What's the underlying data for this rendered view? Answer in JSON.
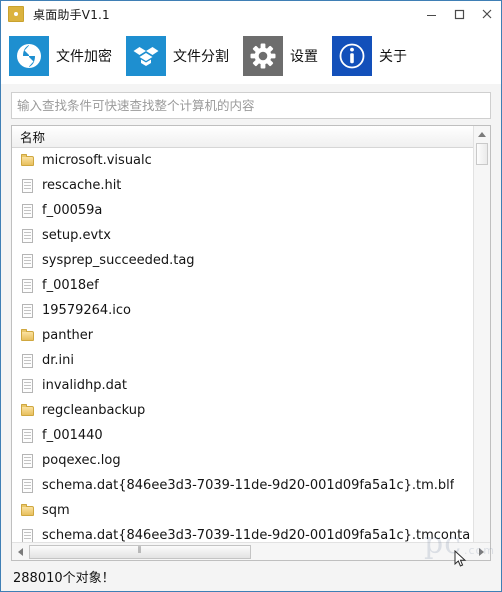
{
  "window": {
    "title": "桌面助手V1.1",
    "app_icon": "app-gold-icon",
    "controls": {
      "minimize": "–",
      "maximize": "▢",
      "close": "✕"
    }
  },
  "toolbar": {
    "items": [
      {
        "label": "文件加密",
        "icon": "file-encrypt-icon",
        "color": "#1e8fd0"
      },
      {
        "label": "文件分割",
        "icon": "file-split-icon",
        "color": "#1e8fd0"
      },
      {
        "label": "设置",
        "icon": "gear-icon",
        "color": "#6d6d6d"
      },
      {
        "label": "关于",
        "icon": "info-icon",
        "color": "#1350ba"
      }
    ]
  },
  "search": {
    "placeholder": "输入查找条件可快速查找整个计算机的内容",
    "value": ""
  },
  "list": {
    "columns": [
      "名称"
    ],
    "rows": [
      {
        "name": "microsoft.visualc",
        "type": "folder"
      },
      {
        "name": "rescache.hit",
        "type": "file"
      },
      {
        "name": "f_00059a",
        "type": "file"
      },
      {
        "name": "setup.evtx",
        "type": "file"
      },
      {
        "name": "sysprep_succeeded.tag",
        "type": "file"
      },
      {
        "name": "f_0018ef",
        "type": "file"
      },
      {
        "name": "19579264.ico",
        "type": "file"
      },
      {
        "name": "panther",
        "type": "folder"
      },
      {
        "name": "dr.ini",
        "type": "file"
      },
      {
        "name": "invalidhp.dat",
        "type": "file"
      },
      {
        "name": "regcleanbackup",
        "type": "folder"
      },
      {
        "name": "f_001440",
        "type": "file"
      },
      {
        "name": "poqexec.log",
        "type": "file"
      },
      {
        "name": "schema.dat{846ee3d3-7039-11de-9d20-001d09fa5a1c}.tm.blf",
        "type": "file"
      },
      {
        "name": "sqm",
        "type": "folder"
      },
      {
        "name": "schema.dat{846ee3d3-7039-11de-9d20-001d09fa5a1c}.tmconta",
        "type": "file"
      }
    ]
  },
  "scrollbars": {
    "vertical": {
      "up_arrow": "▲",
      "thumb_position": "top"
    },
    "horizontal": {
      "left_arrow": "◄",
      "right_arrow": "►",
      "grip": "⦀"
    }
  },
  "status": {
    "text": "288010个对象！"
  },
  "watermark": {
    "text": "pc",
    "suffix": ".com"
  },
  "colors": {
    "window_border": "#3f7fb5",
    "accent_blue": "#1e8fd0",
    "accent_navy": "#1350ba",
    "gear_gray": "#6d6d6d",
    "folder_gold": "#e7bf5e",
    "panel_bg": "#f4f4f4"
  }
}
